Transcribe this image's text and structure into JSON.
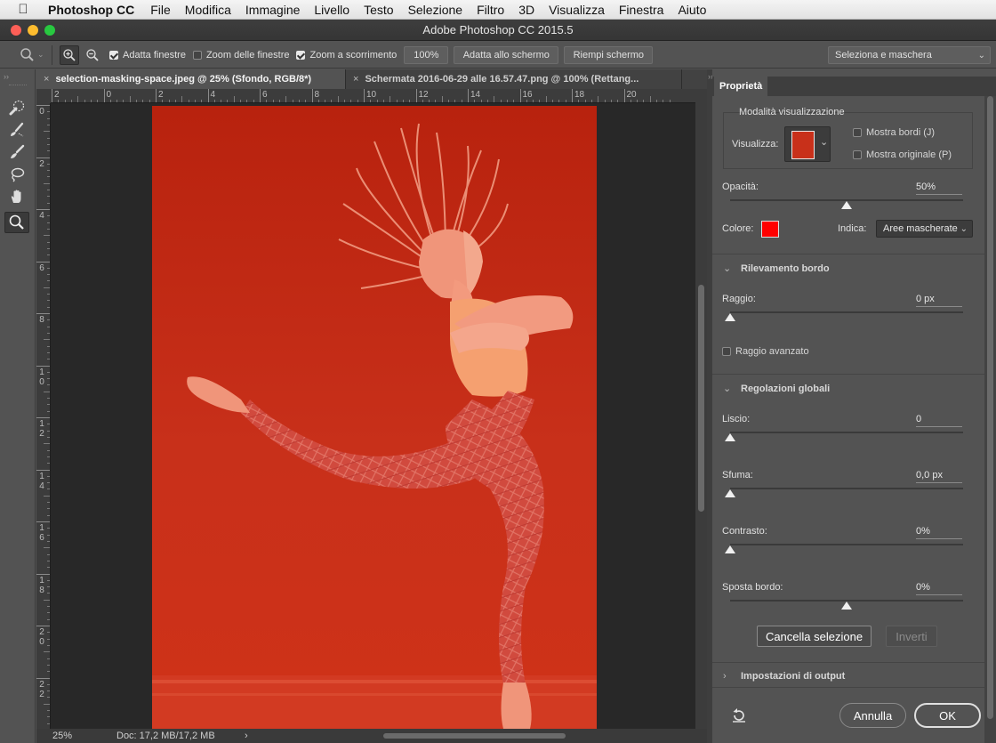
{
  "menubar": {
    "apple_icon": "apple-logo-icon",
    "app_name": "Photoshop CC",
    "items": [
      "File",
      "Modifica",
      "Immagine",
      "Livello",
      "Testo",
      "Selezione",
      "Filtro",
      "3D",
      "Visualizza",
      "Finestra",
      "Aiuto"
    ]
  },
  "window": {
    "title": "Adobe Photoshop CC 2015.5"
  },
  "options": {
    "zoom_in_icon": "zoom-in-icon",
    "zoom_out_icon": "zoom-out-icon",
    "fit_windows": {
      "label": "Adatta finestre",
      "checked": true
    },
    "zoom_all_windows": {
      "label": "Zoom delle finestre",
      "checked": false
    },
    "scrubby_zoom": {
      "label": "Zoom a scorrimento",
      "checked": true
    },
    "zoom_100": "100%",
    "fit_screen": "Adatta allo schermo",
    "fill_screen": "Riempi schermo",
    "workspace_dropdown": "Seleziona e maschera"
  },
  "tools": [
    "quick-selection-icon",
    "refine-edge-brush-icon",
    "brush-icon",
    "lasso-icon",
    "hand-icon",
    "zoom-icon"
  ],
  "tabs": [
    {
      "label": "selection-masking-space.jpeg @ 25% (Sfondo, RGB/8*)",
      "active": true
    },
    {
      "label": "Schermata 2016-06-29 alle 16.57.47.png @ 100% (Rettang...",
      "active": false
    }
  ],
  "ruler": {
    "h_labels": [
      "2",
      "0",
      "2",
      "4",
      "6",
      "8",
      "10",
      "12",
      "14",
      "16",
      "18",
      "20"
    ],
    "v_labels": [
      "0",
      "2",
      "4",
      "6",
      "8",
      "10",
      "12",
      "14",
      "16",
      "18",
      "20",
      "22"
    ]
  },
  "status": {
    "zoom": "25%",
    "doc": "Doc: 17,2 MB/17,2 MB",
    "arrow": "›"
  },
  "properties": {
    "tab": "Proprietà",
    "view_mode": {
      "title": "Modalità visualizzazione",
      "view_label": "Visualizza:",
      "show_edge": "Mostra bordi (J)",
      "show_original": "Mostra originale (P)",
      "show_edge_checked": false,
      "show_original_checked": false
    },
    "opacity": {
      "label": "Opacità:",
      "value": "50%",
      "fraction": 0.5
    },
    "color": {
      "label": "Colore:",
      "swatch": "#ff0000"
    },
    "indicates": {
      "label": "Indica:",
      "value": "Aree mascherate"
    },
    "edge_detection": {
      "title": "Rilevamento bordo",
      "radius_label": "Raggio:",
      "radius_value": "0 px",
      "radius_fraction": 0,
      "smart_radius": "Raggio avanzato",
      "smart_radius_checked": false
    },
    "global": {
      "title": "Regolazioni globali",
      "smooth_label": "Liscio:",
      "smooth_value": "0",
      "smooth_fraction": 0,
      "feather_label": "Sfuma:",
      "feather_value": "0,0 px",
      "feather_fraction": 0,
      "contrast_label": "Contrasto:",
      "contrast_value": "0%",
      "contrast_fraction": 0,
      "shift_label": "Sposta bordo:",
      "shift_value": "0%",
      "shift_fraction": 0.5,
      "clear_btn": "Cancella selezione",
      "invert_btn": "Inverti"
    },
    "output": {
      "title": "Impostazioni di output"
    },
    "footer": {
      "reset_icon": "reset-icon",
      "cancel": "Annulla",
      "ok": "OK"
    }
  }
}
